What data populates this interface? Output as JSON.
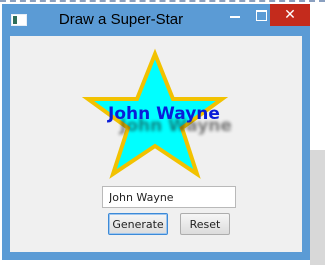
{
  "window": {
    "title": "Draw a Super-Star",
    "close_glyph": "✕",
    "icons": [
      "app-icon",
      "minimize-icon",
      "maximize-icon",
      "close-icon"
    ]
  },
  "star": {
    "label": "John Wayne",
    "fill_color": "#00ffff",
    "stroke_color": "#f2c200",
    "text_color": "#0a1cd8"
  },
  "form": {
    "name_value": "John Wayne",
    "generate_label": "Generate",
    "reset_label": "Reset"
  },
  "colors": {
    "titlebar": "#5b9bd5",
    "client_bg": "#f0f0f0",
    "close_button": "#c42b1c"
  }
}
